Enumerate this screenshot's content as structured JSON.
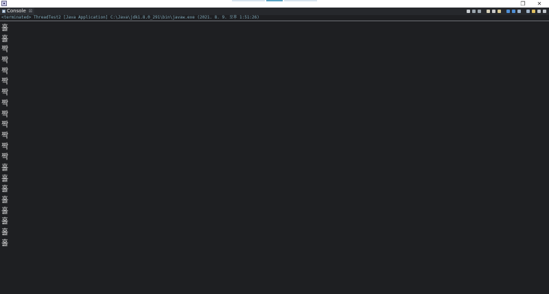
{
  "window": {
    "restore_glyph": "❐",
    "close_glyph": "✕"
  },
  "console_view": {
    "tab_label": "Console",
    "tab_close_label": "☒",
    "status_line": "<terminated> ThreadTest2 [Java Application] C:\\Java\\jdk1.8.0_291\\bin\\javaw.exe (2021. 8. 9. 오후 1:51:26)",
    "toolbar_icons": [
      {
        "name": "stop-icon",
        "color": "#c8ccd0"
      },
      {
        "name": "remove-launch-icon",
        "color": "#9aa4ac"
      },
      {
        "name": "remove-all-icon",
        "color": "#9aa4ac"
      },
      {
        "name": "clear-console-icon",
        "color": "#d9d2b8"
      },
      {
        "name": "scroll-lock-icon",
        "color": "#c9c9c9"
      },
      {
        "name": "word-wrap-icon",
        "color": "#d8c890"
      },
      {
        "name": "show-stdout-icon",
        "color": "#4f8fd6"
      },
      {
        "name": "show-stderr-icon",
        "color": "#4f8fd6"
      },
      {
        "name": "pin-console-icon",
        "color": "#9fb3c8"
      },
      {
        "name": "display-console-icon",
        "color": "#9fb3c8"
      },
      {
        "name": "open-console-icon",
        "color": "#e0c060"
      },
      {
        "name": "minimize-icon",
        "color": "#bfc4c9"
      },
      {
        "name": "maximize-icon",
        "color": "#bfc4c9"
      }
    ]
  },
  "output_lines": [
    "홀",
    "홀",
    "짝",
    "짝",
    "짝",
    "짝",
    "짝",
    "짝",
    "짝",
    "짝",
    "짝",
    "짝",
    "짝",
    "홀",
    "홀",
    "홀",
    "홀",
    "홀",
    "홀",
    "홀",
    "홀"
  ]
}
